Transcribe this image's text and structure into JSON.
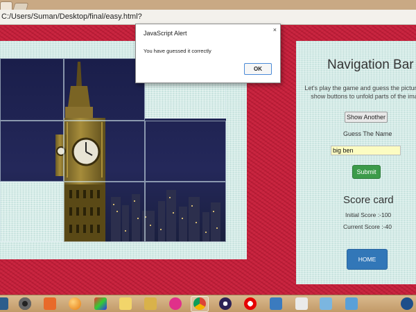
{
  "browser": {
    "url": "C:/Users/Suman/Desktop/final/easy.html?"
  },
  "navigation": {
    "title": "Navigation Bar",
    "instructions_line1": "Let's play the game and guess the picture Cl",
    "instructions_line2": "show buttons to unfold parts of the imag",
    "show_another_label": "Show Another",
    "guess_label": "Guess The Name",
    "guess_value": "big ben",
    "submit_label": "Submit",
    "score_title": "Score card",
    "initial_score": "Initial Score :-100",
    "current_score": "Current Score :-40",
    "home_label": "HOME"
  },
  "alert": {
    "title": "JavaScript Alert",
    "close_glyph": "×",
    "message": "You have guessed it correctly",
    "ok_label": "OK"
  },
  "puzzle": {
    "image_subject": "Big Ben clock tower at night",
    "tiles_revealed": 5,
    "tiles_total": 9
  },
  "taskbar": {
    "icons": [
      "network-icon",
      "webcam-icon",
      "media-player-icon",
      "orange-ball-icon",
      "photo-gallery-icon",
      "folder-icon",
      "file-explorer-icon",
      "social-app-icon",
      "chrome-icon",
      "eclipse-icon",
      "vodafone-icon",
      "virtualbox-icon",
      "notepad-icon",
      "paint-icon",
      "screen-capture-icon",
      "help-icon"
    ]
  }
}
